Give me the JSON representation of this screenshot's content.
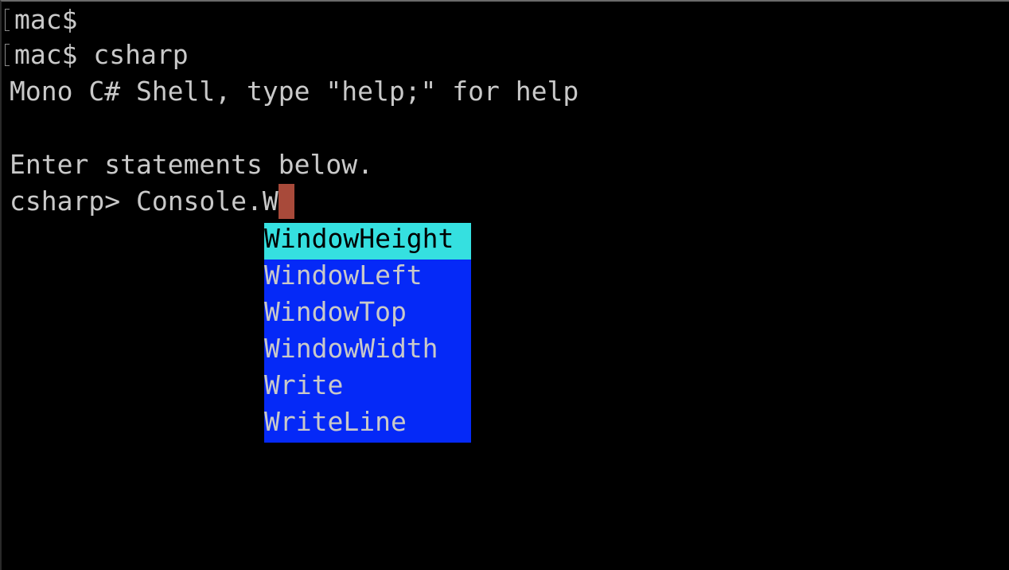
{
  "terminal": {
    "lines": [
      {
        "prompt": "mac$",
        "command": ""
      },
      {
        "prompt": "mac$",
        "command": " csharp"
      }
    ],
    "banner": "Mono C# Shell, type \"help;\" for help",
    "info": "Enter statements below.",
    "input_prompt": "csharp> ",
    "input_text": "Console.W",
    "cursor_color": "#a84a3a"
  },
  "completion": {
    "items": [
      "WindowHeight",
      "WindowLeft",
      "WindowTop",
      "WindowWidth",
      "Write",
      "WriteLine"
    ],
    "selected": "WindowHeight",
    "background": "#0529f7",
    "selected_background": "#35e0e0"
  }
}
